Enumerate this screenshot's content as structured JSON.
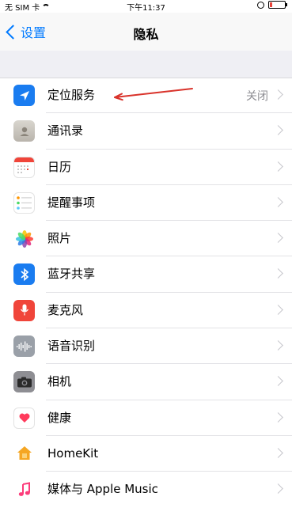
{
  "status_bar": {
    "carrier": "无 SIM 卡",
    "time": "下午11:37"
  },
  "nav": {
    "back_label": "设置",
    "title": "隐私"
  },
  "rows": [
    {
      "label": "定位服务",
      "value": "关闭",
      "icon": "location-arrow-icon",
      "color": "#1a7cf0"
    },
    {
      "label": "通讯录",
      "icon": "contacts-icon"
    },
    {
      "label": "日历",
      "icon": "calendar-icon"
    },
    {
      "label": "提醒事项",
      "icon": "reminders-icon"
    },
    {
      "label": "照片",
      "icon": "photos-icon"
    },
    {
      "label": "蓝牙共享",
      "icon": "bluetooth-icon",
      "color": "#1a7cf0"
    },
    {
      "label": "麦克风",
      "icon": "microphone-icon",
      "color": "#f0453a"
    },
    {
      "label": "语音识别",
      "icon": "speech-recognition-icon"
    },
    {
      "label": "相机",
      "icon": "camera-icon"
    },
    {
      "label": "健康",
      "icon": "health-heart-icon",
      "color": "#ff3b5c"
    },
    {
      "label": "HomeKit",
      "icon": "homekit-icon",
      "color": "#f5a623"
    },
    {
      "label": "媒体与 Apple Music",
      "icon": "music-note-icon",
      "color": "#fc3c7a"
    }
  ],
  "annotation": {
    "color": "#d9332b"
  }
}
